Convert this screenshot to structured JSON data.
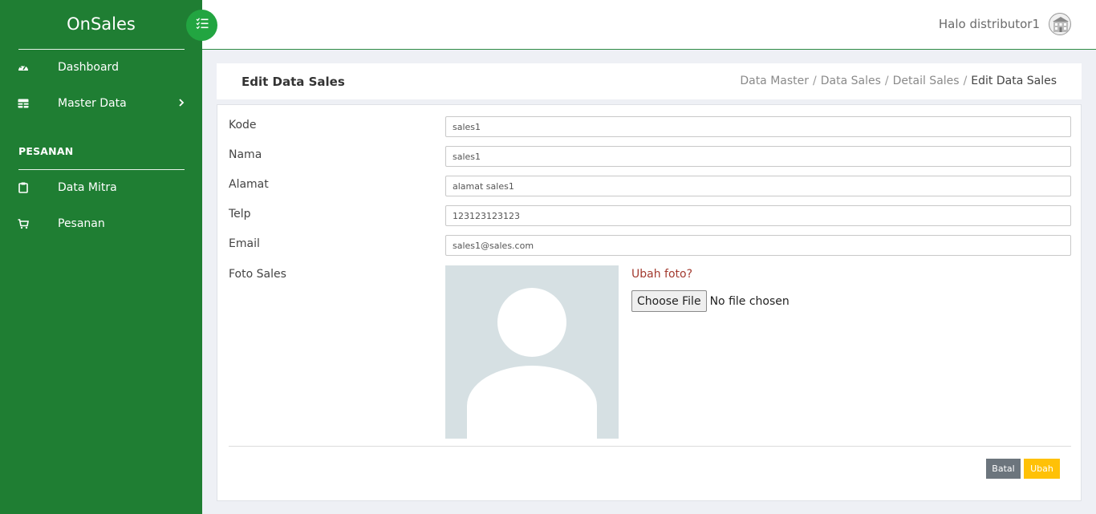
{
  "sidebar": {
    "brand": "OnSales",
    "items": [
      {
        "label": "Dashboard",
        "icon": "tachometer-icon"
      },
      {
        "label": "Master Data",
        "icon": "table-icon"
      }
    ],
    "section_title": "PESANAN",
    "section_items": [
      {
        "label": "Data Mitra",
        "icon": "clipboard-icon"
      },
      {
        "label": "Pesanan",
        "icon": "cart-icon"
      }
    ],
    "bg_color": "#1f7e33"
  },
  "topbar": {
    "greeting": "Halo distributor1"
  },
  "page": {
    "title": "Edit Data Sales",
    "breadcrumb": [
      "Data Master",
      "Data Sales",
      "Detail Sales",
      "Edit Data Sales"
    ]
  },
  "form": {
    "fields": [
      {
        "label": "Kode",
        "value": "sales1"
      },
      {
        "label": "Nama",
        "value": "sales1"
      },
      {
        "label": "Alamat",
        "value": "alamat sales1"
      },
      {
        "label": "Telp",
        "value": "123123123123"
      },
      {
        "label": "Email",
        "value": "sales1@sales.com"
      }
    ],
    "photo_label": "Foto Sales",
    "change_photo": "Ubah foto?",
    "file_button": "Choose File",
    "file_status": "No file chosen",
    "cancel_label": "Batal",
    "submit_label": "Ubah"
  }
}
